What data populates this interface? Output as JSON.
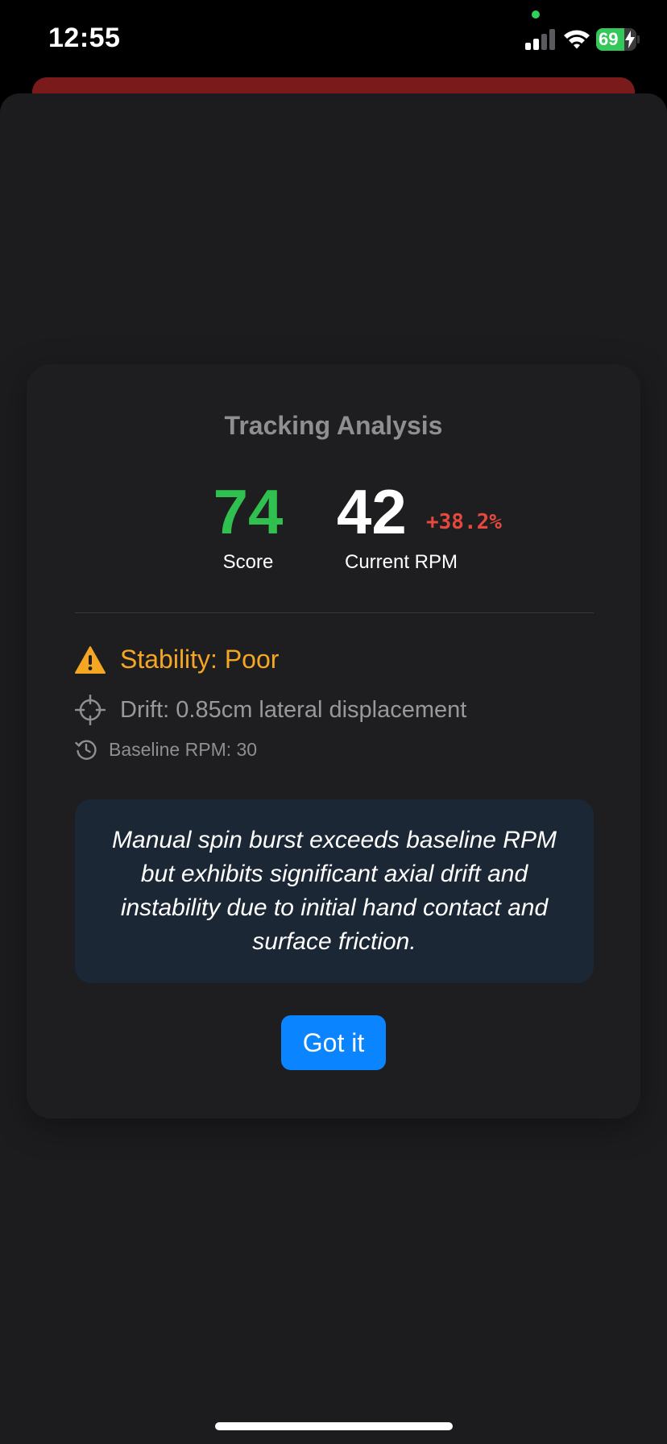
{
  "status_bar": {
    "time": "12:55",
    "battery_percent": "69",
    "battery_level": 0.69,
    "battery_charging": true,
    "signal_bars_active": 2,
    "signal_bars_total": 4,
    "wifi_icon": "wifi-icon",
    "camera_indicator_color": "#30d158",
    "battery_fill_color": "#34c759"
  },
  "dialog": {
    "title": "Tracking Analysis",
    "score": {
      "value": "74",
      "label": "Score",
      "color": "#30c04f"
    },
    "rpm": {
      "value": "42",
      "label": "Current RPM",
      "delta": "+38.2%",
      "delta_color": "#e5483c"
    },
    "stability": {
      "icon": "warning-icon",
      "text": "Stability: Poor",
      "color": "#f5a623"
    },
    "drift": {
      "icon": "crosshair-icon",
      "text": "Drift: 0.85cm lateral displacement"
    },
    "baseline": {
      "icon": "history-icon",
      "text": "Baseline RPM: 30"
    },
    "note": "Manual spin burst exceeds baseline RPM but exhibits significant axial drift and instability due to initial hand contact and surface friction.",
    "button_label": "Got it",
    "button_color": "#0a84ff"
  }
}
